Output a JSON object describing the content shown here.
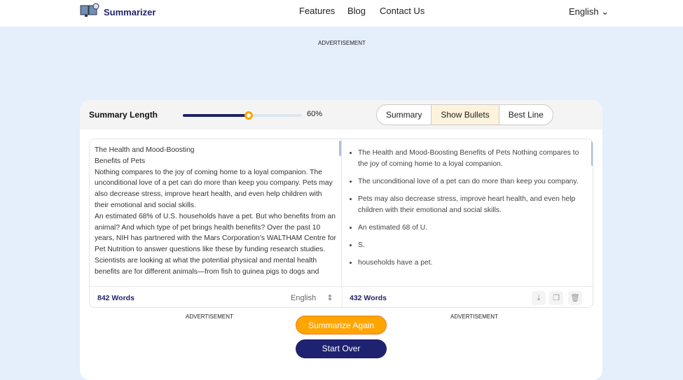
{
  "header": {
    "brand": "Summarizer",
    "nav": [
      "Features",
      "Blog",
      "Contact Us"
    ],
    "language": "English"
  },
  "ads": {
    "top": "ADVERTISEMENT",
    "left": "ADVERTISEMENT",
    "right": "ADVERTISEMENT"
  },
  "controls": {
    "summary_length_label": "Summary Length",
    "summary_length_percent": 60,
    "summary_length_text": "60%",
    "modes": [
      "Summary",
      "Show Bullets",
      "Best Line"
    ],
    "active_mode": "Show Bullets"
  },
  "input": {
    "lines": [
      "The Health and Mood-Boosting",
      "Benefits of Pets",
      "Nothing compares to the joy of coming home to a loyal companion. The unconditional love of a pet can do more than keep you company. Pets may also decrease stress, improve heart health, and even help children with their emotional and social skills.",
      "An estimated 68% of U.S. households have a pet. But who benefits from an animal? And which type of pet brings health benefits? Over the past 10 years, NIH has partnered with the Mars Corporation’s WALTHAM Centre for Pet Nutrition to answer questions like these by funding research studies.",
      "Scientists are looking at what the potential physical and mental health benefits are for different  animals—from fish to guinea pigs to dogs and"
    ],
    "word_count": "842 Words",
    "language": "English"
  },
  "output": {
    "bullets": [
      "The Health and Mood-Boosting Benefits of Pets Nothing compares to the joy of coming home to a loyal companion.",
      "The unconditional love of a pet can do more than keep you company.",
      "Pets may also decrease stress, improve heart health, and even help children with their emotional and social skills.",
      "An estimated 68 of U.",
      "S.",
      "households have a pet."
    ],
    "word_count": "432 Words",
    "icons": [
      "download-icon",
      "copy-icon",
      "trash-icon"
    ]
  },
  "buttons": {
    "summarize_again": "Summarize Again",
    "start_over": "Start Over"
  },
  "colors": {
    "navy": "#1f2270",
    "orange": "#ffa500",
    "active_mode_bg": "#fdf3dc"
  }
}
